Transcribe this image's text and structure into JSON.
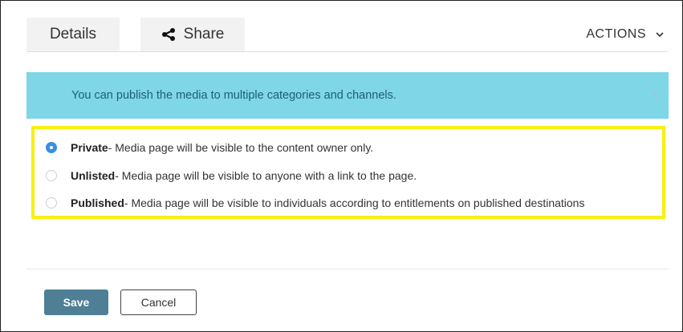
{
  "tabs": {
    "details_label": "Details",
    "share_label": "Share",
    "share_icon": "share-icon",
    "actions_label": "ACTIONS",
    "actions_icon": "chevron-down-icon"
  },
  "alert": {
    "message": "You can publish the media to multiple categories and channels.",
    "close_glyph": "×",
    "background_color": "#7fd6e6"
  },
  "options": [
    {
      "title": "Private",
      "description": " - Media page will be visible to the content owner only.",
      "checked": true
    },
    {
      "title": "Unlisted",
      "description": " - Media page will be visible to anyone with a link to the page.",
      "checked": false
    },
    {
      "title": "Published",
      "description": " - Media page will be visible to individuals according to entitlements on published destinations",
      "checked": false
    }
  ],
  "highlight_color": "#f6f10f",
  "buttons": {
    "save_label": "Save",
    "cancel_label": "Cancel",
    "save_color": "#4e7f95"
  }
}
